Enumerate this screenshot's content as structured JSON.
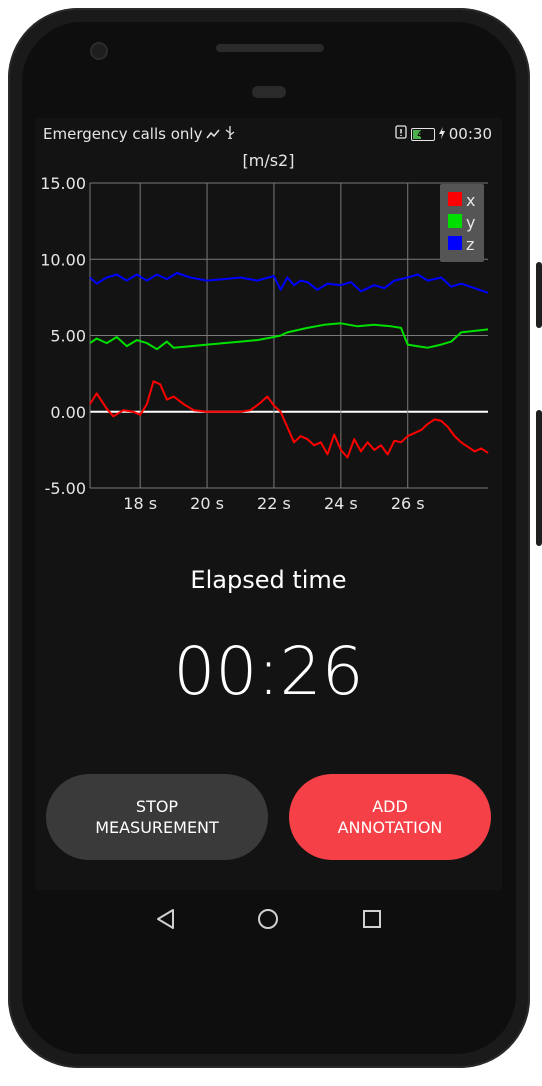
{
  "status_bar": {
    "carrier_text": "Emergency calls only",
    "battery_level": "40",
    "time": "00:30",
    "icons": [
      "signal-icon",
      "usb-icon",
      "sim-alert-icon",
      "battery-icon",
      "charging-icon"
    ]
  },
  "chart_data": {
    "type": "line",
    "title": "[m/s2]",
    "xlabel": "",
    "ylabel": "",
    "x_unit": "s",
    "xlim": [
      16.5,
      28.4
    ],
    "ylim": [
      -5,
      15
    ],
    "y_ticks": [
      "15.00",
      "10.00",
      "5.00",
      "0.00",
      "-5.00"
    ],
    "x_ticks": [
      "18 s",
      "20 s",
      "22 s",
      "24 s",
      "26 s"
    ],
    "x_tick_values": [
      18,
      20,
      22,
      24,
      26
    ],
    "grid": true,
    "legend_position": "top-right",
    "series": [
      {
        "name": "x",
        "color": "#ff0000",
        "x": [
          16.5,
          16.7,
          17.0,
          17.2,
          17.5,
          17.8,
          18.0,
          18.2,
          18.4,
          18.6,
          18.8,
          19.0,
          19.3,
          19.6,
          20.0,
          20.5,
          21.0,
          21.3,
          21.6,
          21.8,
          22.0,
          22.2,
          22.4,
          22.6,
          22.8,
          23.0,
          23.2,
          23.4,
          23.6,
          23.8,
          24.0,
          24.2,
          24.4,
          24.6,
          24.8,
          25.0,
          25.2,
          25.4,
          25.6,
          25.8,
          26.0,
          26.2,
          26.4,
          26.6,
          26.8,
          27.0,
          27.2,
          27.4,
          27.6,
          27.8,
          28.0,
          28.2,
          28.4
        ],
        "y": [
          0.5,
          1.2,
          0.2,
          -0.3,
          0.1,
          0.0,
          -0.2,
          0.5,
          2.0,
          1.8,
          0.8,
          1.0,
          0.5,
          0.1,
          0.0,
          0.0,
          0.0,
          0.1,
          0.6,
          1.0,
          0.4,
          0.0,
          -1.0,
          -2.0,
          -1.6,
          -1.8,
          -2.2,
          -2.0,
          -2.8,
          -1.5,
          -2.5,
          -3.0,
          -1.8,
          -2.6,
          -2.0,
          -2.5,
          -2.2,
          -2.8,
          -1.9,
          -2.0,
          -1.6,
          -1.4,
          -1.2,
          -0.8,
          -0.5,
          -0.6,
          -1.0,
          -1.6,
          -2.0,
          -2.3,
          -2.6,
          -2.4,
          -2.7
        ]
      },
      {
        "name": "y",
        "color": "#00e000",
        "x": [
          16.5,
          16.7,
          17.0,
          17.3,
          17.6,
          17.9,
          18.2,
          18.5,
          18.8,
          19.0,
          19.5,
          20.0,
          20.5,
          21.0,
          21.5,
          22.0,
          22.2,
          22.4,
          22.6,
          22.8,
          23.0,
          23.5,
          24.0,
          24.5,
          25.0,
          25.5,
          25.8,
          26.0,
          26.3,
          26.6,
          27.0,
          27.3,
          27.6,
          28.0,
          28.4
        ],
        "y": [
          4.5,
          4.8,
          4.5,
          4.9,
          4.3,
          4.7,
          4.5,
          4.1,
          4.6,
          4.2,
          4.3,
          4.4,
          4.5,
          4.6,
          4.7,
          4.9,
          5.0,
          5.2,
          5.3,
          5.4,
          5.5,
          5.7,
          5.8,
          5.6,
          5.7,
          5.6,
          5.5,
          4.4,
          4.3,
          4.2,
          4.4,
          4.6,
          5.2,
          5.3,
          5.4
        ]
      },
      {
        "name": "z",
        "color": "#0000ff",
        "x": [
          16.5,
          16.7,
          17.0,
          17.3,
          17.6,
          17.9,
          18.2,
          18.5,
          18.8,
          19.1,
          19.5,
          20.0,
          20.5,
          21.0,
          21.5,
          22.0,
          22.2,
          22.4,
          22.6,
          22.8,
          23.0,
          23.3,
          23.6,
          24.0,
          24.3,
          24.6,
          25.0,
          25.3,
          25.6,
          26.0,
          26.3,
          26.6,
          27.0,
          27.3,
          27.6,
          28.0,
          28.4
        ],
        "y": [
          8.8,
          8.4,
          8.8,
          9.0,
          8.6,
          9.0,
          8.6,
          9.0,
          8.7,
          9.1,
          8.8,
          8.6,
          8.7,
          8.8,
          8.6,
          8.9,
          8.0,
          8.8,
          8.3,
          8.6,
          8.5,
          8.0,
          8.4,
          8.3,
          8.5,
          7.9,
          8.3,
          8.1,
          8.6,
          8.8,
          9.0,
          8.6,
          8.8,
          8.2,
          8.4,
          8.1,
          7.8
        ]
      }
    ]
  },
  "main": {
    "elapsed_label": "Elapsed time",
    "elapsed_value": "00:26"
  },
  "buttons": {
    "stop_label": "STOP\nMEASUREMENT",
    "annotation_label": "ADD\nANNOTATION"
  },
  "nav": {
    "icons": [
      "back-icon",
      "home-icon",
      "recents-icon"
    ]
  }
}
